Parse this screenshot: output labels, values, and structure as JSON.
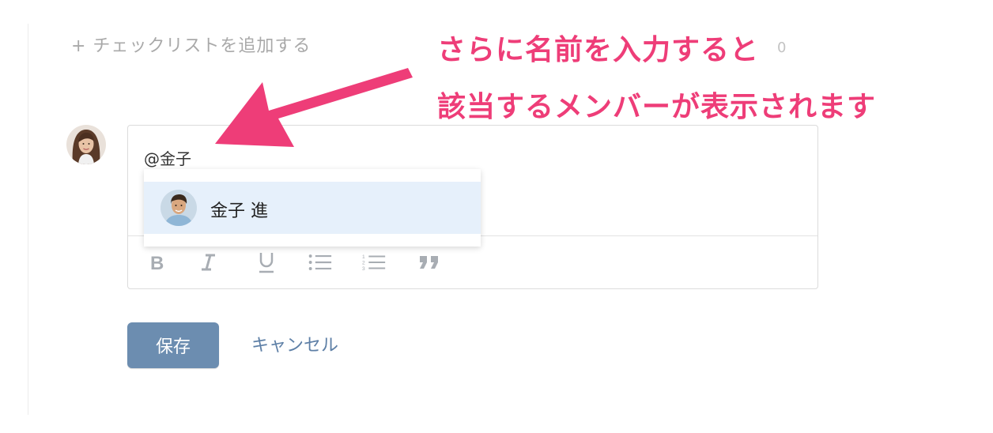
{
  "checklist": {
    "add_label": "+ チェックリストを追加する"
  },
  "counter": {
    "text": "0"
  },
  "annotation": {
    "line1": "さらに名前を入力すると",
    "line2": "該当するメンバーが表示されます",
    "color": "#ee3d78"
  },
  "comment_editor": {
    "input_value": "@金子",
    "toolbar": [
      {
        "icon": "bold-icon"
      },
      {
        "icon": "italic-icon"
      },
      {
        "icon": "underline-icon"
      },
      {
        "icon": "bulleted-list-icon"
      },
      {
        "icon": "numbered-list-icon"
      },
      {
        "icon": "quote-icon"
      }
    ]
  },
  "mention_suggestions": [
    {
      "name": "金子 進",
      "highlighted": true
    }
  ],
  "actions": {
    "save_label": "保存",
    "cancel_label": "キャンセル"
  },
  "colors": {
    "save_bg": "#6c8db0",
    "link": "#5d7fa6",
    "highlight": "#e6f0fb"
  }
}
